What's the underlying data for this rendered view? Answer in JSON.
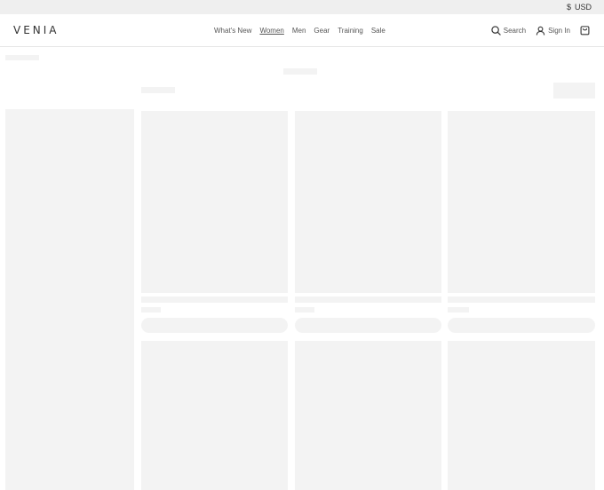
{
  "topbar": {
    "currency_symbol": "$",
    "currency_code": "USD"
  },
  "header": {
    "logo": "VENIA",
    "nav": [
      {
        "label": "What's New"
      },
      {
        "label": "Women"
      },
      {
        "label": "Men"
      },
      {
        "label": "Gear"
      },
      {
        "label": "Training"
      },
      {
        "label": "Sale"
      }
    ],
    "search_label": "Search",
    "signin_label": "Sign In"
  },
  "icons": {
    "search": "search-icon",
    "account": "user-icon",
    "cart": "shopping-bag-icon"
  },
  "colors": {
    "skeleton": "#f3f3f3",
    "topbar_bg": "#efefef",
    "text": "#333333"
  },
  "page_state": "loading-skeleton"
}
